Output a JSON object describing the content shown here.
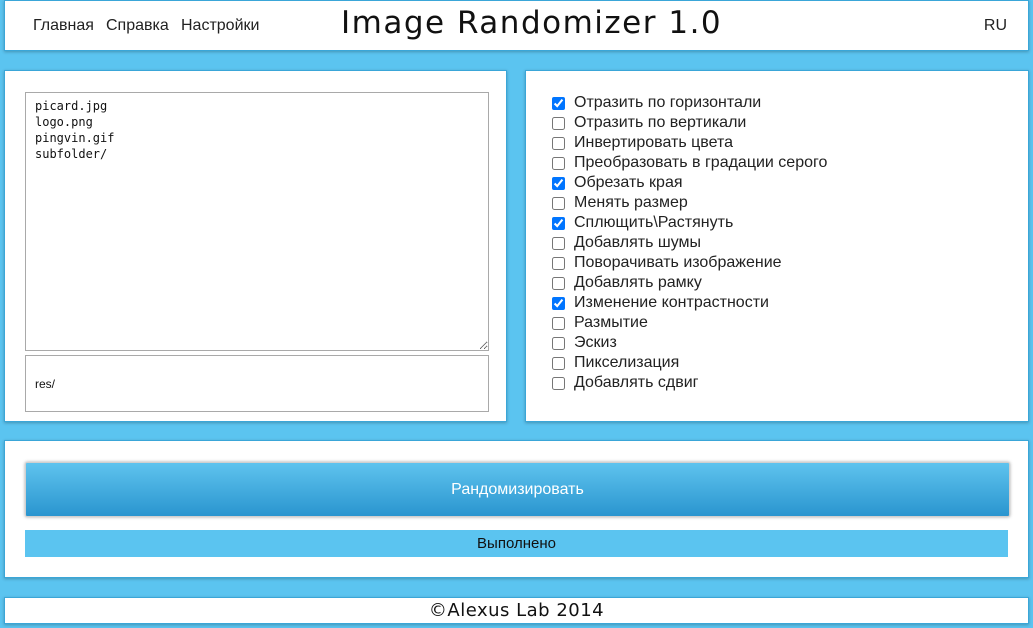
{
  "header": {
    "nav": [
      "Главная",
      "Справка",
      "Настройки"
    ],
    "title": "Image Randomizer 1.0",
    "language": "RU"
  },
  "input": {
    "files": "picard.jpg\nlogo.png\npingvin.gif\nsubfolder/",
    "output_folder": "res/"
  },
  "options": [
    {
      "label": "Отразить по горизонтали",
      "checked": true
    },
    {
      "label": "Отразить по вертикали",
      "checked": false
    },
    {
      "label": "Инвертировать цвета",
      "checked": false
    },
    {
      "label": "Преобразовать в градации серого",
      "checked": false
    },
    {
      "label": "Обрезать края",
      "checked": true
    },
    {
      "label": "Менять размер",
      "checked": false
    },
    {
      "label": "Сплющить\\Растянуть",
      "checked": true
    },
    {
      "label": "Добавлять шумы",
      "checked": false
    },
    {
      "label": "Поворачивать изображение",
      "checked": false
    },
    {
      "label": "Добавлять рамку",
      "checked": false
    },
    {
      "label": "Изменение контрастности",
      "checked": true
    },
    {
      "label": "Размытие",
      "checked": false
    },
    {
      "label": "Эскиз",
      "checked": false
    },
    {
      "label": "Пикселизация",
      "checked": false
    },
    {
      "label": "Добавлять сдвиг",
      "checked": false
    }
  ],
  "action": {
    "randomize_label": "Рандомизировать",
    "status": "Выполнено"
  },
  "footer": {
    "copyright": "©Alexus Lab 2014"
  },
  "colors": {
    "background": "#5bc4f0",
    "button_top": "#5fc3ee",
    "button_bottom": "#2a95cf",
    "status_bar": "#5bc4f0"
  }
}
